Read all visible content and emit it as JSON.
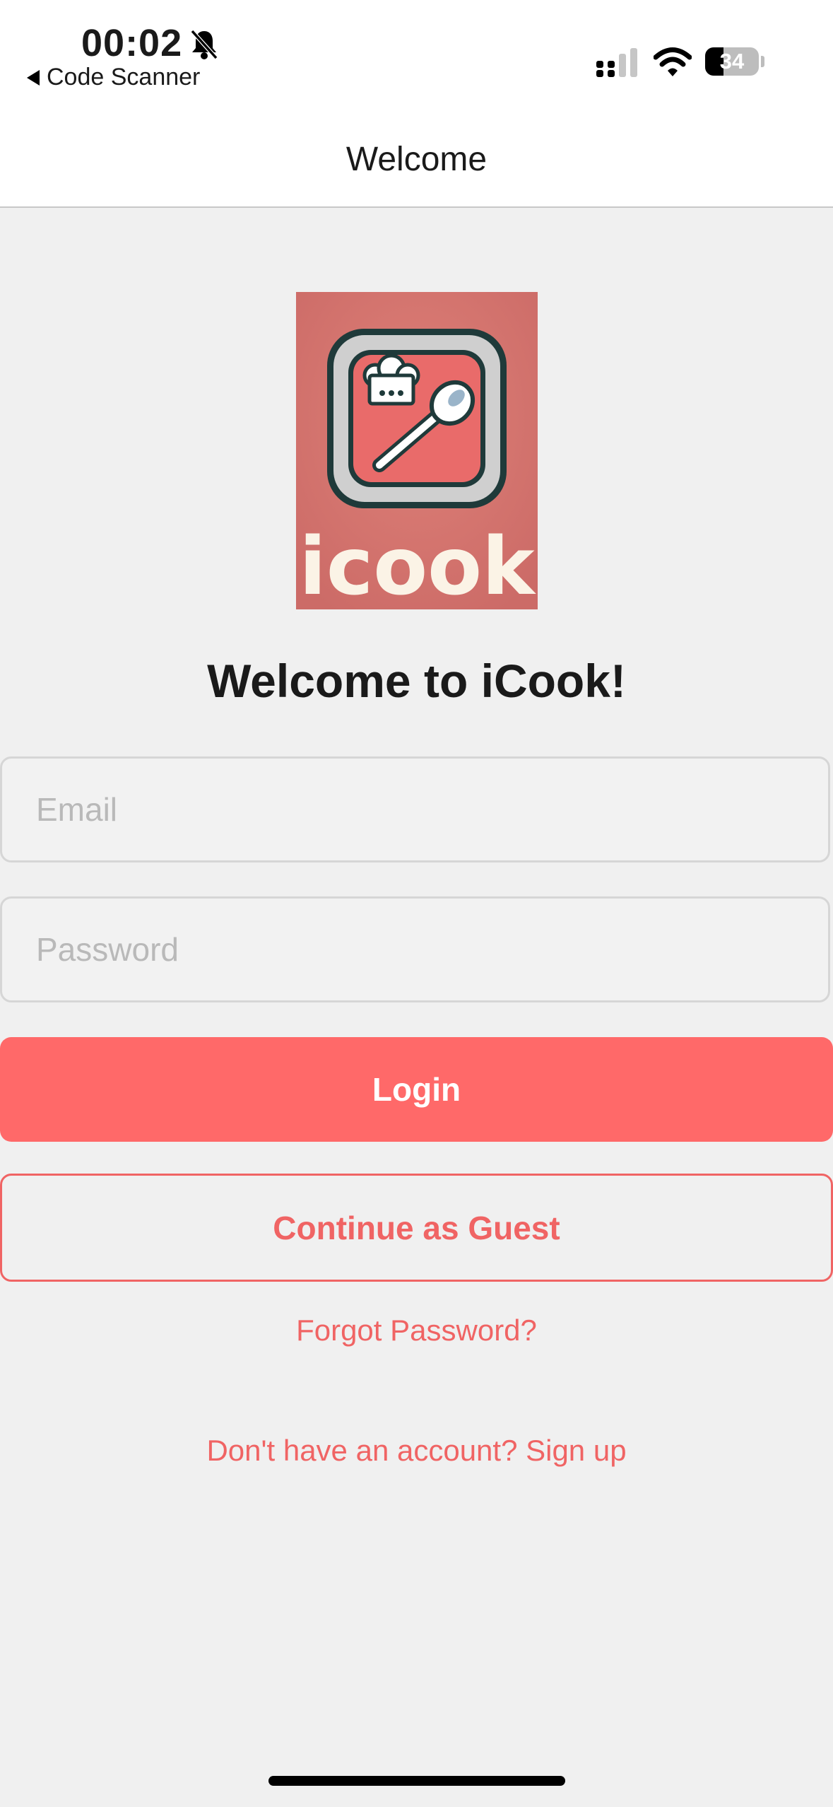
{
  "status_bar": {
    "time": "00:02",
    "back_app_label": "Code Scanner",
    "battery_level": "34",
    "icons": [
      "bell-slash-icon",
      "cellular-signal-icon",
      "wifi-icon",
      "battery-icon"
    ]
  },
  "nav": {
    "title": "Welcome"
  },
  "logo": {
    "text": "icook",
    "colors": {
      "background": "#d9736e",
      "plate": "#e86a6a",
      "frame": "#cfcfcf",
      "outline": "#1f3a3a",
      "text": "#fbf3e6"
    }
  },
  "login": {
    "headline": "Welcome to iCook!",
    "email_placeholder": "Email",
    "password_placeholder": "Password",
    "login_label": "Login",
    "guest_label": "Continue as Guest",
    "forgot_label": "Forgot Password?",
    "signup_label": "Don't have an account? Sign up"
  },
  "colors": {
    "accent": "#ff6969",
    "link": "#f06464",
    "background": "#f0f0f0",
    "header": "#ffffff"
  }
}
